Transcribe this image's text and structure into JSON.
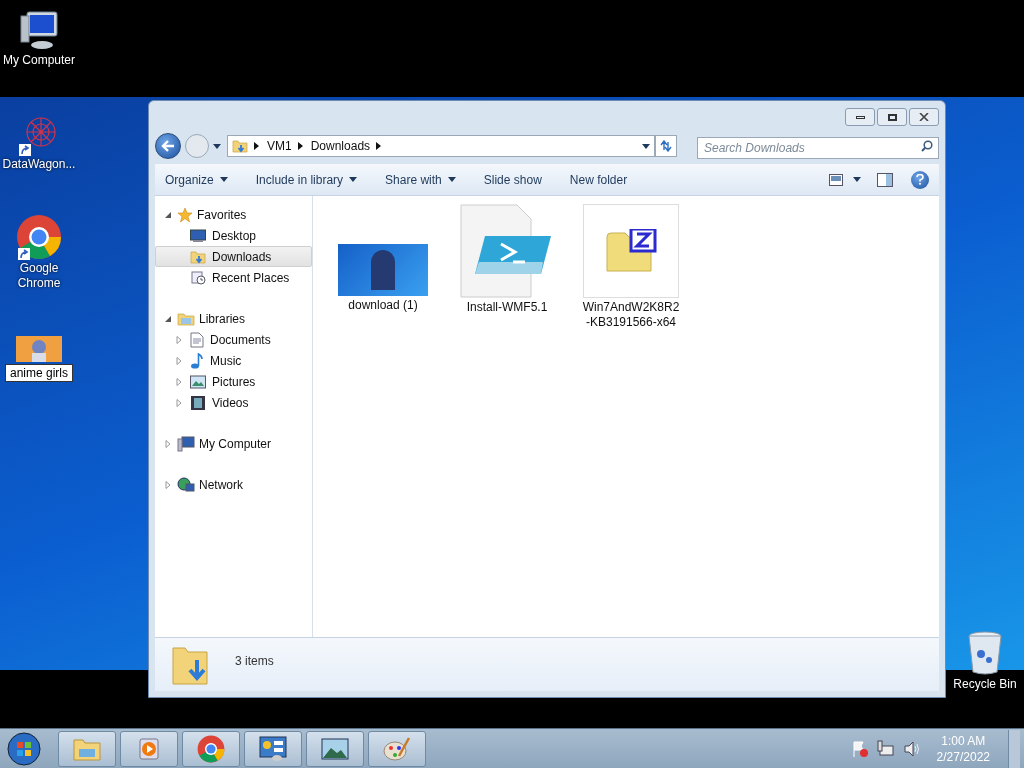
{
  "desktop_icons": [
    {
      "label": "My Computer",
      "kind": "computer",
      "shortcut": false,
      "selected": false
    },
    {
      "label": "DataWagon...",
      "kind": "app",
      "shortcut": true,
      "selected": false
    },
    {
      "label": "Google Chrome",
      "kind": "browser",
      "shortcut": true,
      "selected": false
    },
    {
      "label": "anime girls",
      "kind": "image",
      "shortcut": false,
      "selected": true
    },
    {
      "label": "Recycle Bin",
      "kind": "bin",
      "shortcut": false,
      "selected": false
    }
  ],
  "window": {
    "address": {
      "crumbs": [
        "VM1",
        "Downloads"
      ]
    },
    "search": {
      "placeholder": "Search Downloads"
    },
    "toolbar": [
      {
        "label": "Organize",
        "dropdown": true
      },
      {
        "label": "Include in library",
        "dropdown": true
      },
      {
        "label": "Share with",
        "dropdown": true
      },
      {
        "label": "Slide show",
        "dropdown": false
      },
      {
        "label": "New folder",
        "dropdown": false
      }
    ],
    "nav": [
      {
        "label": "Favorites",
        "kind": "star",
        "expanded": true,
        "children": [
          {
            "label": "Desktop",
            "kind": "desktop",
            "selected": false
          },
          {
            "label": "Downloads",
            "kind": "downloads",
            "selected": true
          },
          {
            "label": "Recent Places",
            "kind": "recent",
            "selected": false
          }
        ]
      },
      {
        "label": "Libraries",
        "kind": "library",
        "expanded": true,
        "children": [
          {
            "label": "Documents",
            "kind": "documents",
            "selected": false,
            "expanded": false
          },
          {
            "label": "Music",
            "kind": "music",
            "selected": false,
            "expanded": false
          },
          {
            "label": "Pictures",
            "kind": "pictures",
            "selected": false,
            "expanded": false
          },
          {
            "label": "Videos",
            "kind": "videos",
            "selected": false,
            "expanded": false
          }
        ]
      },
      {
        "label": "My Computer",
        "kind": "computer",
        "expanded": false
      },
      {
        "label": "Network",
        "kind": "network",
        "expanded": false
      }
    ],
    "files": [
      {
        "name": "download (1)",
        "kind": "image"
      },
      {
        "name": "Install-WMF5.1",
        "kind": "script"
      },
      {
        "name": "Win7AndW2K8R2-KB3191566-x64",
        "kind": "archive"
      }
    ],
    "status": "3 items"
  },
  "clock": {
    "time": "1:00 AM",
    "date": "2/27/2022"
  }
}
